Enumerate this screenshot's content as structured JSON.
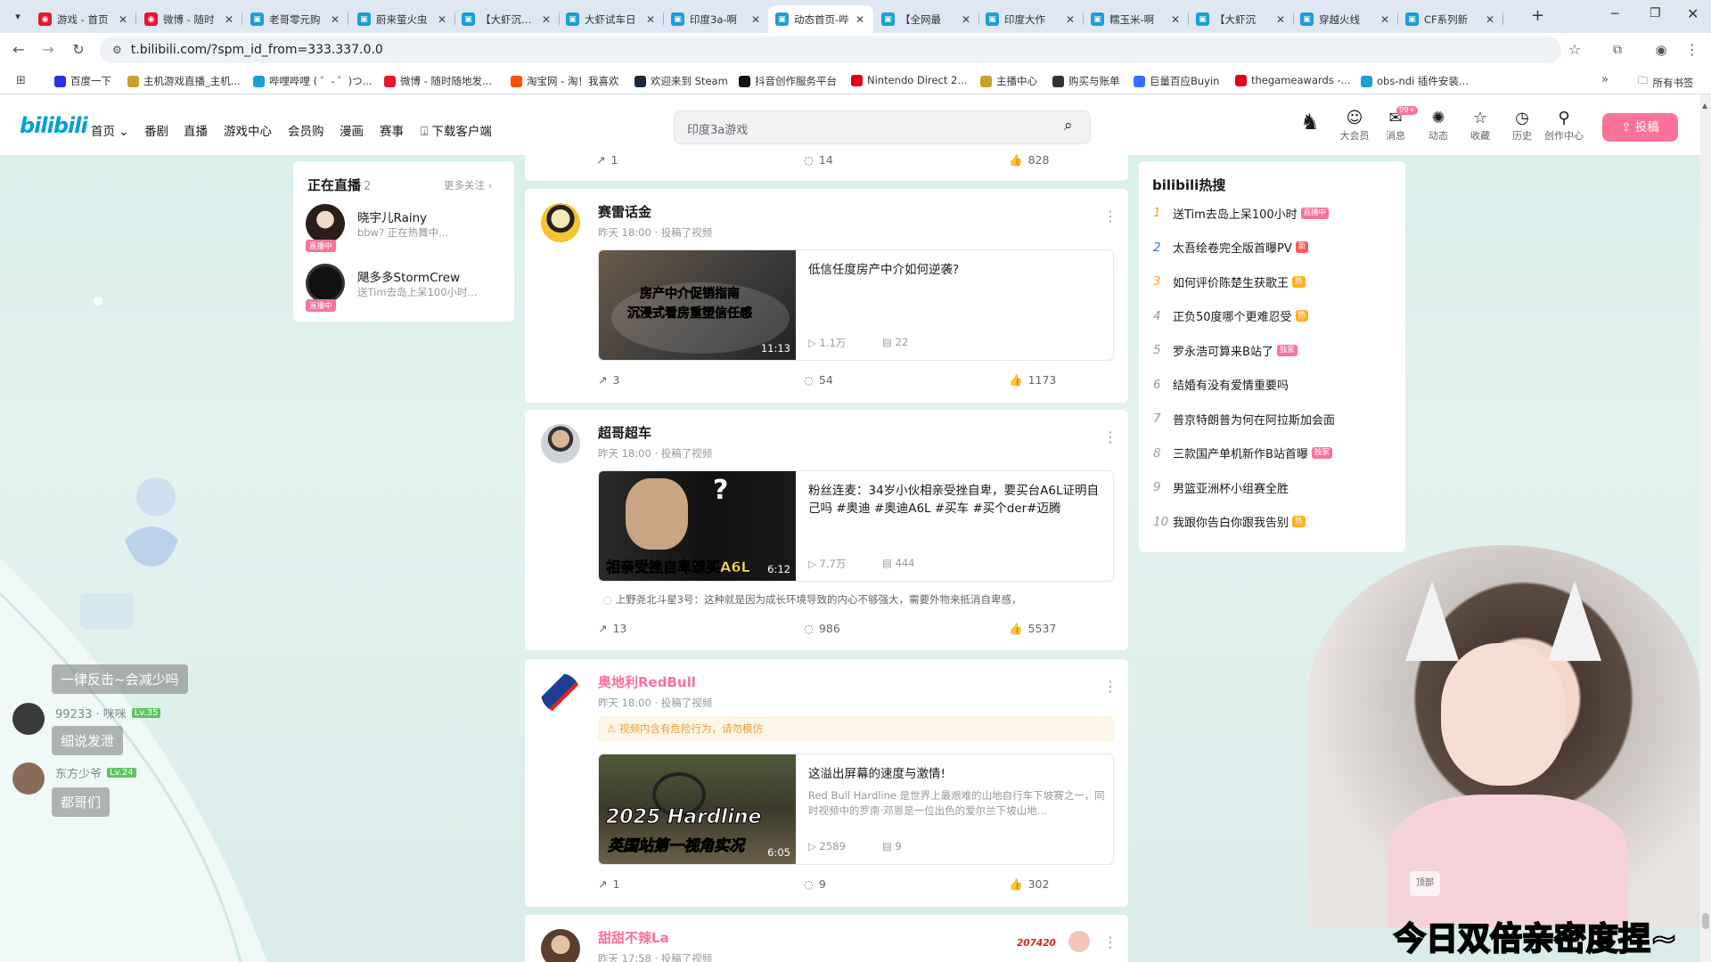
{
  "browser": {
    "tabs": [
      {
        "title": "游戏 - 首页",
        "icon": "weibo"
      },
      {
        "title": "微博 - 随时",
        "icon": "weibo"
      },
      {
        "title": "老哥零元购",
        "icon": "bili"
      },
      {
        "title": "蔚来萤火虫",
        "icon": "bili"
      },
      {
        "title": "【大虾沉浸】",
        "icon": "bili"
      },
      {
        "title": "大虾试车日",
        "icon": "bili"
      },
      {
        "title": "印度3a-啊",
        "icon": "bili"
      },
      {
        "title": "动态首页-哔",
        "icon": "bili",
        "active": true
      },
      {
        "title": "【全网最",
        "icon": "bili"
      },
      {
        "title": "印度大作",
        "icon": "bili"
      },
      {
        "title": "糯玉米-啊",
        "icon": "bili"
      },
      {
        "title": "【大虾沉",
        "icon": "bili"
      },
      {
        "title": "穿越火线",
        "icon": "bili"
      },
      {
        "title": "CF系列新",
        "icon": "bili"
      }
    ],
    "url": "t.bilibili.com/?spm_id_from=333.337.0.0",
    "bookmarks": [
      {
        "label": "百度一下",
        "color": "#2932e1"
      },
      {
        "label": "主机游戏直播_主机...",
        "color": "#c9a227"
      },
      {
        "label": "哔哩哔哩 ( ゜- ゜)つ...",
        "color": "#1a9fd6"
      },
      {
        "label": "微博 - 随时随地发...",
        "color": "#e6162d"
      },
      {
        "label": "淘宝网 - 淘！我喜欢",
        "color": "#ff5000"
      },
      {
        "label": "欢迎来到 Steam",
        "color": "#1b2838"
      },
      {
        "label": "抖音创作服务平台",
        "color": "#111111"
      },
      {
        "label": "Nintendo Direct 2...",
        "color": "#e60012"
      },
      {
        "label": "主播中心",
        "color": "#c9a227"
      },
      {
        "label": "购买与账单",
        "color": "#333333"
      },
      {
        "label": "巨量百应Buyin",
        "color": "#3370ff"
      },
      {
        "label": "thegameawards -...",
        "color": "#e60012"
      },
      {
        "label": "obs-ndi 插件安装...",
        "color": "#1a9fd6"
      }
    ],
    "all_bookmarks": "所有书签"
  },
  "header": {
    "logo": "bilibili",
    "nav": [
      "首页",
      "番剧",
      "直播",
      "游戏中心",
      "会员购",
      "漫画",
      "赛事",
      "下载客户端"
    ],
    "search_placeholder": "印度3a游戏",
    "icons": [
      {
        "label": "大会员",
        "icon": "vip-icon"
      },
      {
        "label": "消息",
        "icon": "message-icon",
        "badge": "99+"
      },
      {
        "label": "动态",
        "icon": "dynamic-icon"
      },
      {
        "label": "收藏",
        "icon": "favorite-icon"
      },
      {
        "label": "历史",
        "icon": "history-icon"
      },
      {
        "label": "创作中心",
        "icon": "creator-icon"
      }
    ],
    "upload": "投稿"
  },
  "live": {
    "title": "正在直播",
    "count": "2",
    "more": "更多关注",
    "items": [
      {
        "name": "晓宇儿Rainy",
        "desc": "bbw? 正在热舞中...",
        "badge": "直播中"
      },
      {
        "name": "飓多多StormCrew",
        "desc": "送Tim去岛上呆100小时...",
        "badge": "直播中"
      }
    ]
  },
  "feed": {
    "top_stats": {
      "share": "1",
      "comment": "14",
      "like": "828"
    },
    "posts": [
      {
        "user": "赛雷话金",
        "meta": "昨天 18:00 · 投稿了视频",
        "video_title": "低信任度房产中介如何逆袭?",
        "thumb_text_1": "房产中介促销指南",
        "thumb_text_2": "沉浸式看房重塑信任感",
        "duration": "11:13",
        "views": "1.1万",
        "danmaku": "22",
        "share": "3",
        "comment": "54",
        "like": "1173"
      },
      {
        "user": "超哥超车",
        "meta": "昨天 18:00 · 投稿了视频",
        "video_title": "粉丝连麦：34岁小伙相亲受挫自卑，要买台A6L证明自己吗 #奥迪 #奥迪A6L #买车 #买个der#迈腾",
        "thumb_text_1": "相亲受挫自卑想买A6L",
        "duration": "6:12",
        "views": "7.7万",
        "danmaku": "444",
        "top_comment": "上野尧北斗星3号：这种就是因为成长环境导致的内心不够强大，需要外物来抵消自卑感，",
        "share": "13",
        "comment": "986",
        "like": "5537"
      },
      {
        "user": "奥地利RedBull",
        "meta": "昨天 18:00 · 投稿了视频",
        "warning": "视频内含有危险行为，请勿模仿",
        "video_title": "这溢出屏幕的速度与激情!",
        "video_desc": "Red Bull Hardline 是世界上最艰难的山地自行车下坡赛之一，同时视频中的罗南·邓恩是一位出色的爱尔兰下坡山地...",
        "thumb_text_1": "2025 Hardline",
        "thumb_text_2": "英国站第一视角实况",
        "duration": "6:05",
        "views": "2589",
        "danmaku": "9",
        "share": "1",
        "comment": "9",
        "like": "302"
      },
      {
        "user": "甜甜不辣La",
        "meta": "昨天 17:58 · 投稿了视频",
        "number": "207420"
      }
    ]
  },
  "hot": {
    "title": "bilibili热搜",
    "items": [
      {
        "rank": "1",
        "text": "送Tim去岛上呆100小时",
        "tag": "直播中",
        "tag_color": "#fb7299"
      },
      {
        "rank": "2",
        "text": "太吾绘卷完全版首曝PV",
        "tag": "新",
        "tag_color": "#f85a54"
      },
      {
        "rank": "3",
        "text": "如何评价陈楚生获歌王",
        "tag": "热",
        "tag_color": "#ffb027"
      },
      {
        "rank": "4",
        "text": "正负50度哪个更难忍受",
        "tag": "热",
        "tag_color": "#ffb027"
      },
      {
        "rank": "5",
        "text": "罗永浩可算来B站了",
        "tag": "独家",
        "tag_color": "#fb7299"
      },
      {
        "rank": "6",
        "text": "结婚有没有爱情重要吗",
        "tag": "",
        "tag_color": ""
      },
      {
        "rank": "7",
        "text": "普京特朗普为何在阿拉斯加会面",
        "tag": "",
        "tag_color": ""
      },
      {
        "rank": "8",
        "text": "三款国产单机新作B站首曝",
        "tag": "独家",
        "tag_color": "#fb7299"
      },
      {
        "rank": "9",
        "text": "男篮亚洲杯小组赛全胜",
        "tag": "",
        "tag_color": ""
      },
      {
        "rank": "10",
        "text": "我跟你告白你跟我告别",
        "tag": "热",
        "tag_color": "#ffb027"
      }
    ]
  },
  "overlay": {
    "chat": [
      {
        "kind": "msg",
        "text": "一律反击~会减少吗"
      },
      {
        "kind": "user",
        "name": "99233 · 咪咪",
        "level": "Lv.35"
      },
      {
        "kind": "msg",
        "text": "细说发泄"
      },
      {
        "kind": "user",
        "name": "东方少爷",
        "level": "Lv.24"
      },
      {
        "kind": "msg",
        "text": "都哥们"
      }
    ],
    "caption": "今日双倍亲密度捏~",
    "back_top": "顶部"
  }
}
